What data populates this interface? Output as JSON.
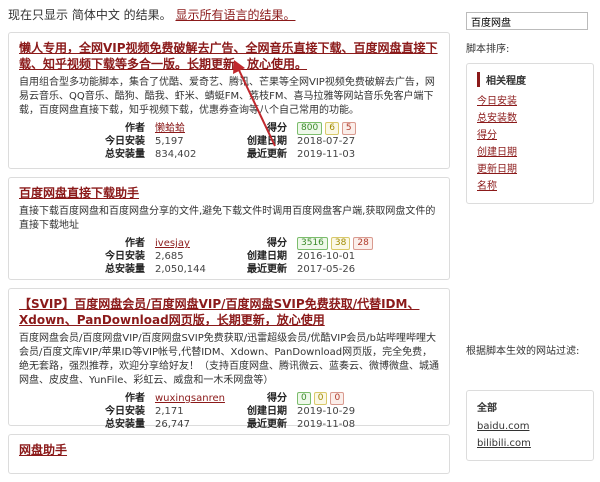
{
  "topbar": {
    "notice": "现在只显示 简体中文 的结果。",
    "show_all_link": "显示所有语言的结果。"
  },
  "labels": {
    "author": "作者",
    "today": "今日安装",
    "total": "总安装量",
    "score": "得分",
    "created": "创建日期",
    "updated": "最近更新"
  },
  "scripts": [
    {
      "title": "懒人专用，全网VIP视频免费破解去广告、全网音乐直接下载、百度网盘直接下载、知乎视频下载等多合一版。长期更新，放心使用。",
      "desc": "自用组合型多功能脚本，集合了优酷、爱奇艺、腾讯、芒果等全网VIP视频免费破解去广告，网易云音乐、QQ音乐、酷狗、酷我、虾米、蜻蜓FM、荔枝FM、喜马拉雅等网站音乐免客户端下载，百度网盘直接下载，知乎视频下载，优惠券查询等八个自己常用的功能。",
      "author": "懒蛤蛤",
      "today": "5,197",
      "total": "834,402",
      "rating": [
        "800",
        "6",
        "5"
      ],
      "created": "2018-07-27",
      "updated": "2019-11-03"
    },
    {
      "title": "百度网盘直接下载助手",
      "desc": "直接下载百度网盘和百度网盘分享的文件,避免下载文件时调用百度网盘客户端,获取网盘文件的直接下载地址",
      "author": "ivesjay",
      "today": "2,685",
      "total": "2,050,144",
      "rating": [
        "3516",
        "38",
        "28"
      ],
      "created": "2016-10-01",
      "updated": "2017-05-26"
    },
    {
      "title": "【SVIP】百度网盘会员/百度网盘VIP/百度网盘SVIP免费获取/代替IDM、Xdown、PanDownload网页版，长期更新，放心使用",
      "desc": "百度网盘会员/百度网盘VIP/百度网盘SVIP免费获取/迅雷超级会员/优酷VIP会员/b站哔哩哔哩大会员/百度文库VIP/苹果ID等VIP帐号,代替IDM、Xdown、PanDownload网页版，完全免费，绝无套路，强烈推荐，欢迎分享给好友！（支持百度网盘、腾讯微云、蓝奏云、微博微盘、城通网盘、皮皮盘、YunFile、彩虹云、威盘和一木禾网盘等）",
      "author": "wuxingsanren",
      "today": "2,171",
      "total": "26,747",
      "rating": [
        "0",
        "0",
        "0"
      ],
      "created": "2019-10-29",
      "updated": "2019-11-08"
    },
    {
      "title": "网盘助手"
    }
  ],
  "sidebar": {
    "search_value": "百度网盘",
    "sort_label": "脚本排序:",
    "sort_header": "相关程度",
    "sort_options": [
      "今日安装",
      "总安装数",
      "得分",
      "创建日期",
      "更新日期",
      "名称"
    ],
    "filter_label": "根据脚本生效的网站过滤:",
    "filter_header": "全部",
    "filter_sites": [
      "baidu.com",
      "bilibili.com"
    ]
  },
  "colors": {
    "link": "#8b1a1a",
    "arrow": "#c0282d"
  }
}
